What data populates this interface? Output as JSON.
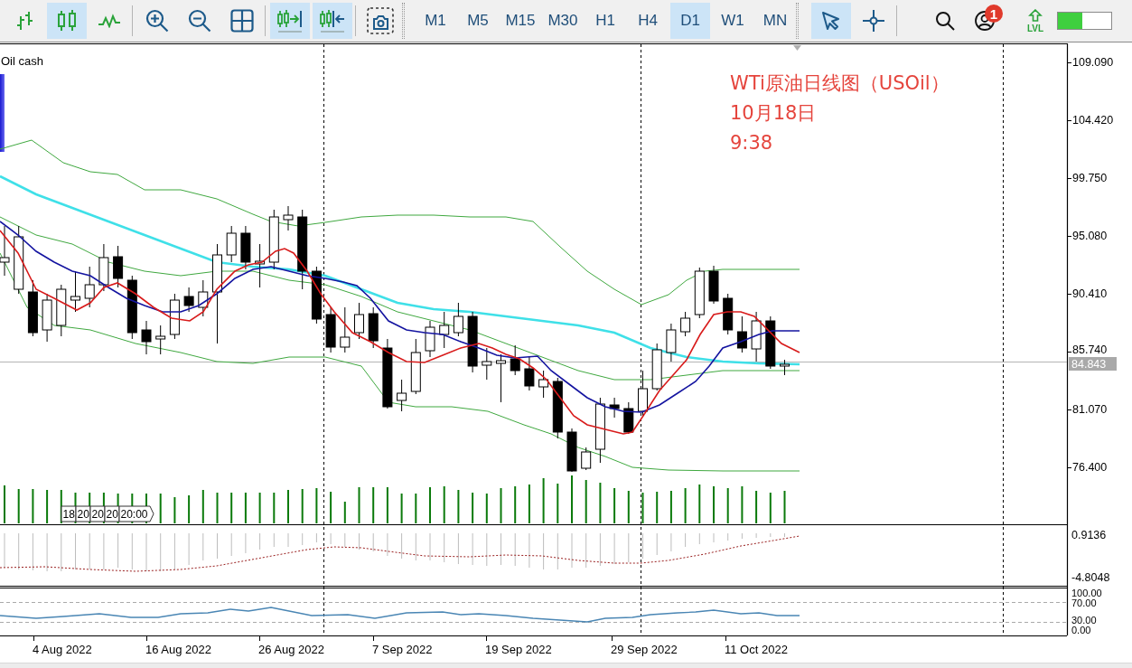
{
  "toolbar": {
    "tool_groups": [
      [
        {
          "kind": "bars",
          "selected": false
        },
        {
          "kind": "candles",
          "selected": true
        },
        {
          "kind": "line",
          "selected": false
        }
      ],
      [
        {
          "kind": "zoomin",
          "selected": false
        },
        {
          "kind": "zoomout",
          "selected": false
        },
        {
          "kind": "tile",
          "selected": false
        }
      ],
      [
        {
          "kind": "autoscroll",
          "selected": true
        },
        {
          "kind": "shift",
          "selected": true
        }
      ],
      [
        {
          "kind": "screenshot",
          "selected": false
        }
      ]
    ],
    "timeframes": [
      {
        "label": "M1",
        "selected": false
      },
      {
        "label": "M5",
        "selected": false
      },
      {
        "label": "M15",
        "selected": false
      },
      {
        "label": "M30",
        "selected": false
      },
      {
        "label": "H1",
        "selected": false
      },
      {
        "label": "H4",
        "selected": false
      },
      {
        "label": "D1",
        "selected": true
      },
      {
        "label": "W1",
        "selected": false
      },
      {
        "label": "MN",
        "selected": false
      }
    ],
    "pointer_tools": [
      {
        "kind": "cursor",
        "selected": true
      },
      {
        "kind": "crosshair",
        "selected": false
      }
    ],
    "account": {
      "badge": "1"
    },
    "level_button": {
      "label": "LVL"
    },
    "level_meter": {
      "level": 0.45
    }
  },
  "chart": {
    "symbol": "Oil cash",
    "annotation": [
      "WTi原油日线图（USOil）",
      "10月18日",
      "9:38"
    ],
    "price_axis": [
      "109.090",
      "104.420",
      "99.750",
      "95.080",
      "90.410",
      "85.740",
      "81.070",
      "76.400"
    ],
    "current_price": "84.843",
    "volume_labels": [
      "18",
      "20",
      "20",
      "20",
      "20:00"
    ],
    "oscillator_axis": [
      "0.9136",
      "-4.8048"
    ],
    "rsi_axis": [
      "100.00",
      "70.00",
      "30.00",
      "0.00"
    ],
    "time_axis": [
      "4 Aug 2022",
      "16 Aug 2022",
      "26 Aug 2022",
      "7 Sep 2022",
      "19 Sep 2022",
      "29 Sep 2022",
      "11 Oct 2022"
    ]
  }
}
